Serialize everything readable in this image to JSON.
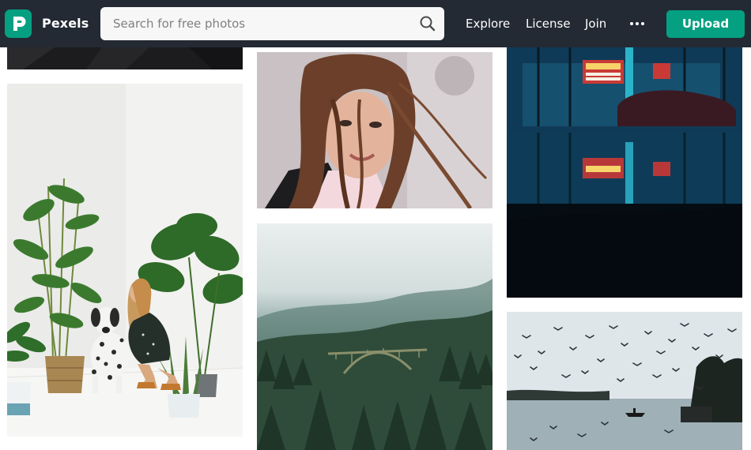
{
  "header": {
    "brand": "Pexels",
    "logo_icon": "pexels-p-logo-icon",
    "search": {
      "placeholder": "Search for free photos",
      "icon": "search-icon"
    },
    "nav": [
      {
        "label": "Explore"
      },
      {
        "label": "License"
      },
      {
        "label": "Join"
      }
    ],
    "more_icon": "ellipsis-icon",
    "upload_label": "Upload"
  },
  "colors": {
    "header_bg": "#232a34",
    "accent": "#05a081",
    "search_bg": "#f7f7f7"
  },
  "gallery": {
    "photos": [
      {
        "subject": "dark fabric close-up"
      },
      {
        "subject": "woman with dalmatian and potted plants"
      },
      {
        "subject": "woman with windblown hair"
      },
      {
        "subject": "foggy forest with arch bridge"
      },
      {
        "subject": "Tower theater neon sign reflected in puddle"
      },
      {
        "subject": "flock of birds over lake with boat"
      }
    ]
  }
}
